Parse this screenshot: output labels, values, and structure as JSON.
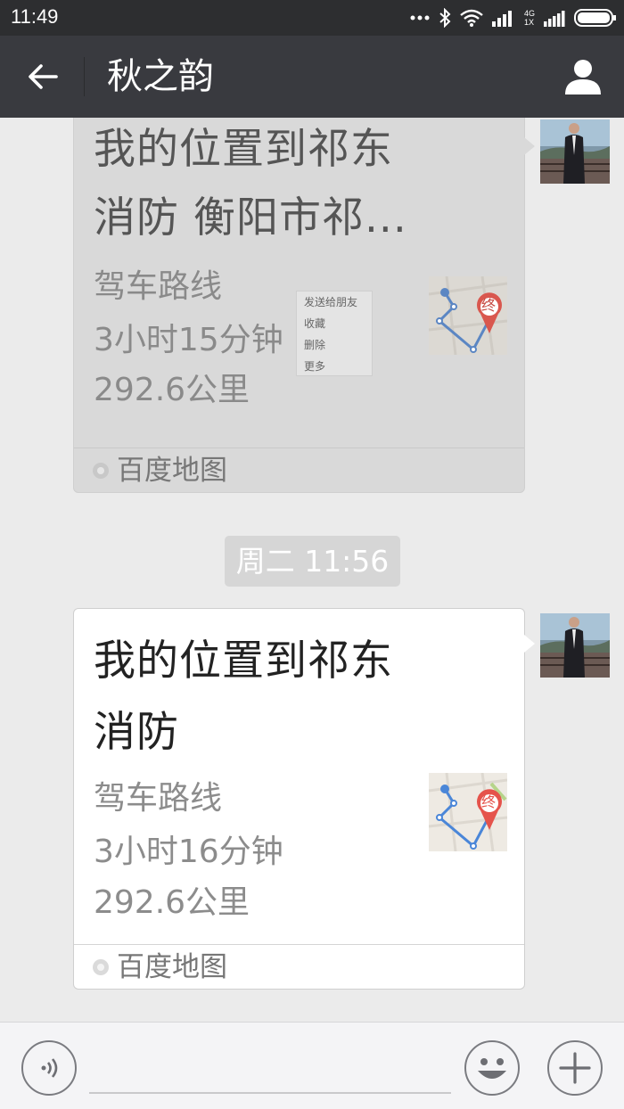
{
  "status_bar": {
    "time": "11:49",
    "network_label": "4G",
    "network_sublabel": "1X",
    "icons": [
      "more-dots-icon",
      "bluetooth-icon",
      "wifi-icon",
      "signal-icon",
      "battery-icon"
    ]
  },
  "header": {
    "title": "秋之韵",
    "back_icon": "back-arrow-icon",
    "profile_icon": "user-profile-icon"
  },
  "messages": [
    {
      "title_line1": "我的位置到祁东",
      "title_line2": "消防 衡阳市祁...",
      "route_type": "驾车路线",
      "duration": "3小时15分钟",
      "distance": "292.6公里",
      "source": "百度地图",
      "map_marker": "终",
      "state": "selected"
    },
    {
      "title_line1": "我的位置到祁东",
      "title_line2": "消防",
      "route_type": "驾车路线",
      "duration": "3小时16分钟",
      "distance": "292.6公里",
      "source": "百度地图",
      "map_marker": "终",
      "state": "normal"
    }
  ],
  "context_menu": [
    "发送给朋友",
    "收藏",
    "删除",
    "更多"
  ],
  "timestamp": "周二 11:56",
  "input_bar": {
    "voice_icon": "voice-icon",
    "emoji_icon": "emoji-icon",
    "plus_icon": "plus-icon"
  },
  "colors": {
    "status_bar": "#2d2e30",
    "title_bar": "#393a3f",
    "chat_background": "#ebebeb",
    "map_marker_red": "#e5534b",
    "route_blue": "#4a86d8"
  }
}
